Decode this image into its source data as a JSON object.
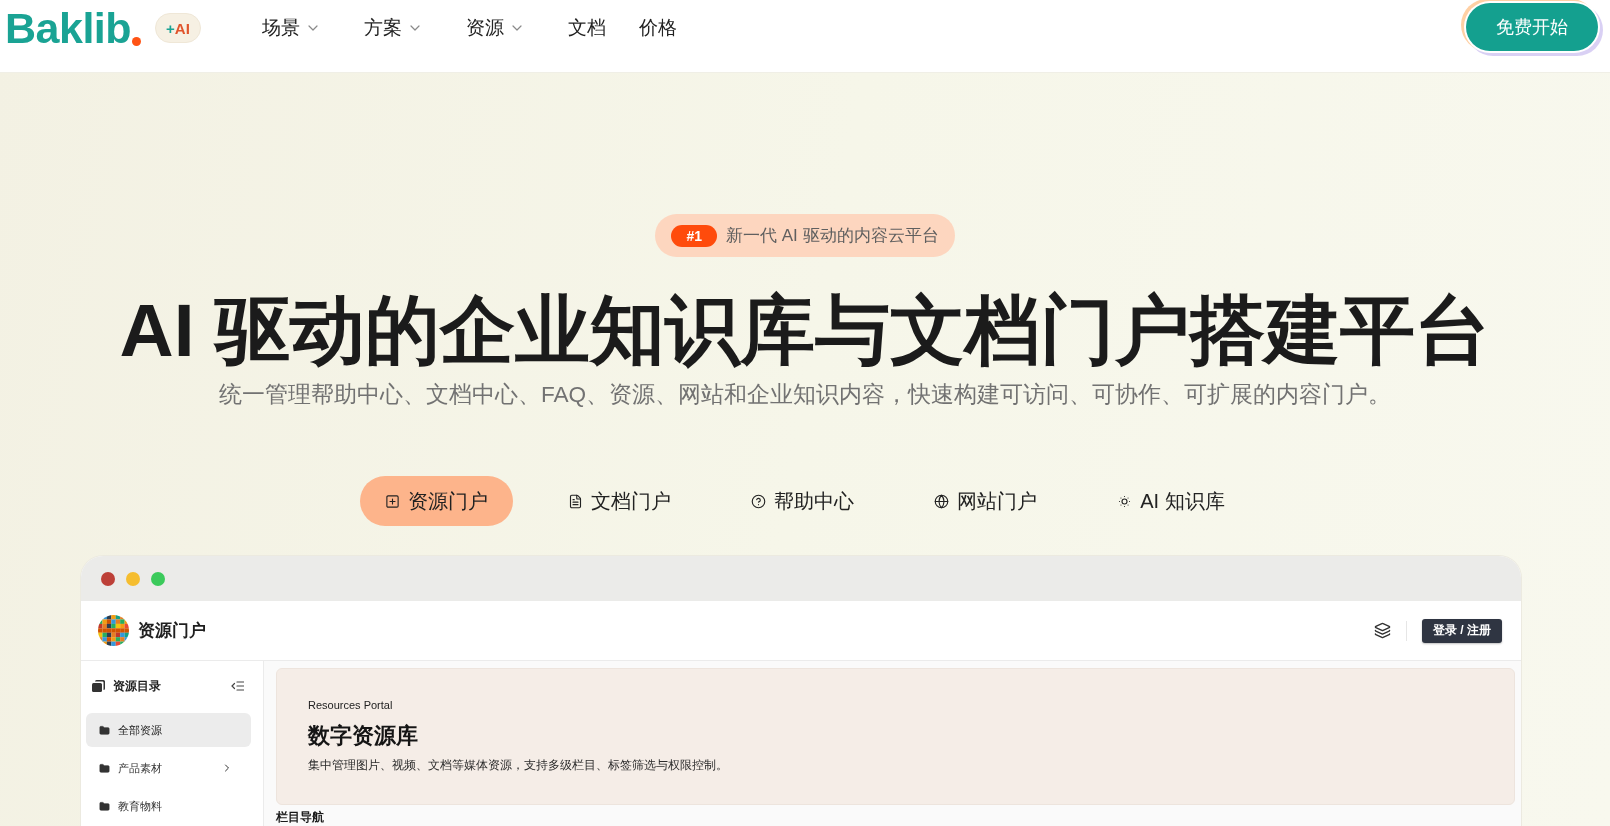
{
  "nav": {
    "logo": "Baklib",
    "ai_badge": {
      "prefix": "+",
      "label": "AI"
    },
    "items": [
      {
        "label": "场景",
        "has_menu": true
      },
      {
        "label": "方案",
        "has_menu": true
      },
      {
        "label": "资源",
        "has_menu": true
      },
      {
        "label": "文档",
        "has_menu": false
      },
      {
        "label": "价格",
        "has_menu": false
      }
    ],
    "cta": "免费开始"
  },
  "hero": {
    "badge": {
      "rank": "#1",
      "text": "新一代 AI 驱动的内容云平台"
    },
    "title": "AI 驱动的企业知识库与文档门户搭建平台",
    "subtitle": "统一管理帮助中心、文档中心、FAQ、资源、网站和企业知识内容，快速构建可访问、可协作、可扩展的内容门户。"
  },
  "tabs": [
    {
      "label": "资源门户",
      "kind": "resources",
      "selected": true
    },
    {
      "label": "文档门户",
      "kind": "docs",
      "selected": false
    },
    {
      "label": "帮助中心",
      "kind": "help",
      "selected": false
    },
    {
      "label": "网站门户",
      "kind": "website",
      "selected": false
    },
    {
      "label": "AI 知识库",
      "kind": "ai",
      "selected": false
    }
  ],
  "preview": {
    "window_controls": [
      {
        "color": "#bd4038"
      },
      {
        "color": "#f5bd2f"
      },
      {
        "color": "#3bca5b"
      }
    ],
    "site_title": "资源门户",
    "login": "登录 / 注册",
    "sidebar": {
      "title": "资源目录",
      "items": [
        {
          "label": "全部资源",
          "selected": true,
          "has_children": false
        },
        {
          "label": "产品素材",
          "selected": false,
          "has_children": true
        },
        {
          "label": "教育物料",
          "selected": false,
          "has_children": false
        }
      ]
    },
    "banner": {
      "eyebrow": "Resources Portal",
      "title": "数字资源库",
      "description": "集中管理图片、视频、文档等媒体资源，支持多级栏目、标签筛选与权限控制。"
    },
    "section_title": "栏目导航"
  }
}
